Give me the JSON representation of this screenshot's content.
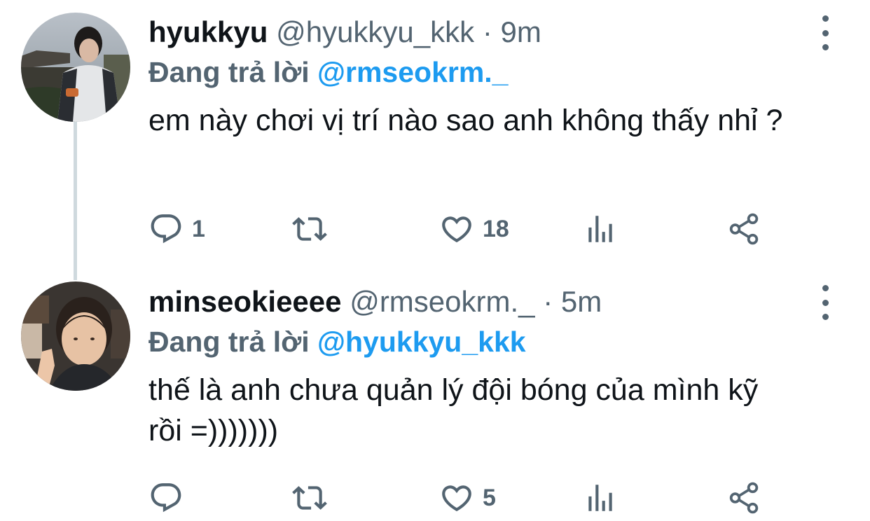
{
  "tweets": [
    {
      "display_name": "hyukkyu",
      "handle": "@hyukkyu_kkk",
      "separator": "·",
      "time": "9m",
      "reply_prefix": "Đang trả lời",
      "reply_to": "@rmseokrm._",
      "text": "em này chơi vị trí nào sao anh không thấy nhỉ ?",
      "reply_count": "1",
      "retweet_count": "",
      "like_count": "18"
    },
    {
      "display_name": "minseokieeee",
      "handle": "@rmseokrm._",
      "separator": "·",
      "time": "5m",
      "reply_prefix": "Đang trả lời",
      "reply_to": "@hyukkyu_kkk",
      "text": "thế là anh chưa quản lý đội bóng của mình kỹ rồi =)))))))",
      "reply_count": "",
      "retweet_count": "",
      "like_count": "5"
    }
  ],
  "icons": {
    "reply": "reply-icon",
    "retweet": "retweet-icon",
    "like": "heart-icon",
    "views": "views-icon",
    "share": "share-icon",
    "more": "more-icon"
  },
  "colors": {
    "text": "#0f1419",
    "secondary": "#536471",
    "mention": "#1d9bf0",
    "thread_line": "#cfd9de"
  }
}
